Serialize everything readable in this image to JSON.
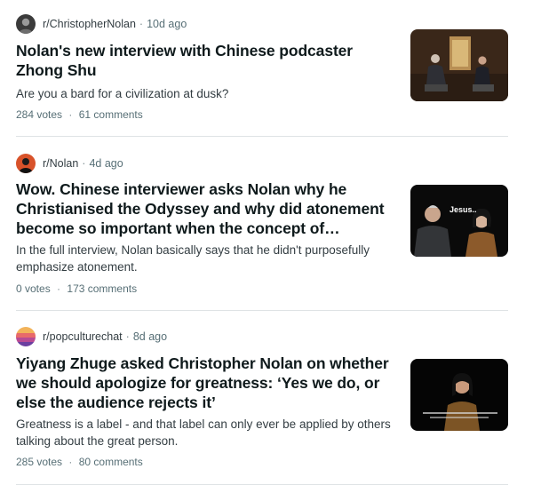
{
  "posts": [
    {
      "subreddit": "r/ChristopherNolan",
      "age": "10d ago",
      "title": "Nolan's new interview with Chinese podcaster Zhong Shu",
      "body": "Are you a bard for a civilization at dusk?",
      "votes": "284 votes",
      "comments": "61 comments"
    },
    {
      "subreddit": "r/Nolan",
      "age": "4d ago",
      "title": "Wow. Chinese interviewer asks Nolan why he Christianised the Odyssey and why did atonement become so important when the concept of atonement is…",
      "body": "In the full interview, Nolan basically says that he didn't purposefully emphasize atonement.",
      "votes": "0 votes",
      "comments": "173 comments",
      "thumb_caption": "Jesus.."
    },
    {
      "subreddit": "r/popculturechat",
      "age": "8d ago",
      "title": "Yiyang Zhuge asked Christopher Nolan on whether we should apologize for greatness: ‘Yes we do, or else the audience rejects it’",
      "body": "Greatness is a label - and that label can only ever be applied by others talking about the great person.",
      "votes": "285 votes",
      "comments": "80 comments"
    }
  ],
  "separator": "·",
  "colors": {
    "meta": "#576f76",
    "title": "#0f1a1c",
    "body": "#333d42",
    "divider": "#dfe3e5"
  }
}
